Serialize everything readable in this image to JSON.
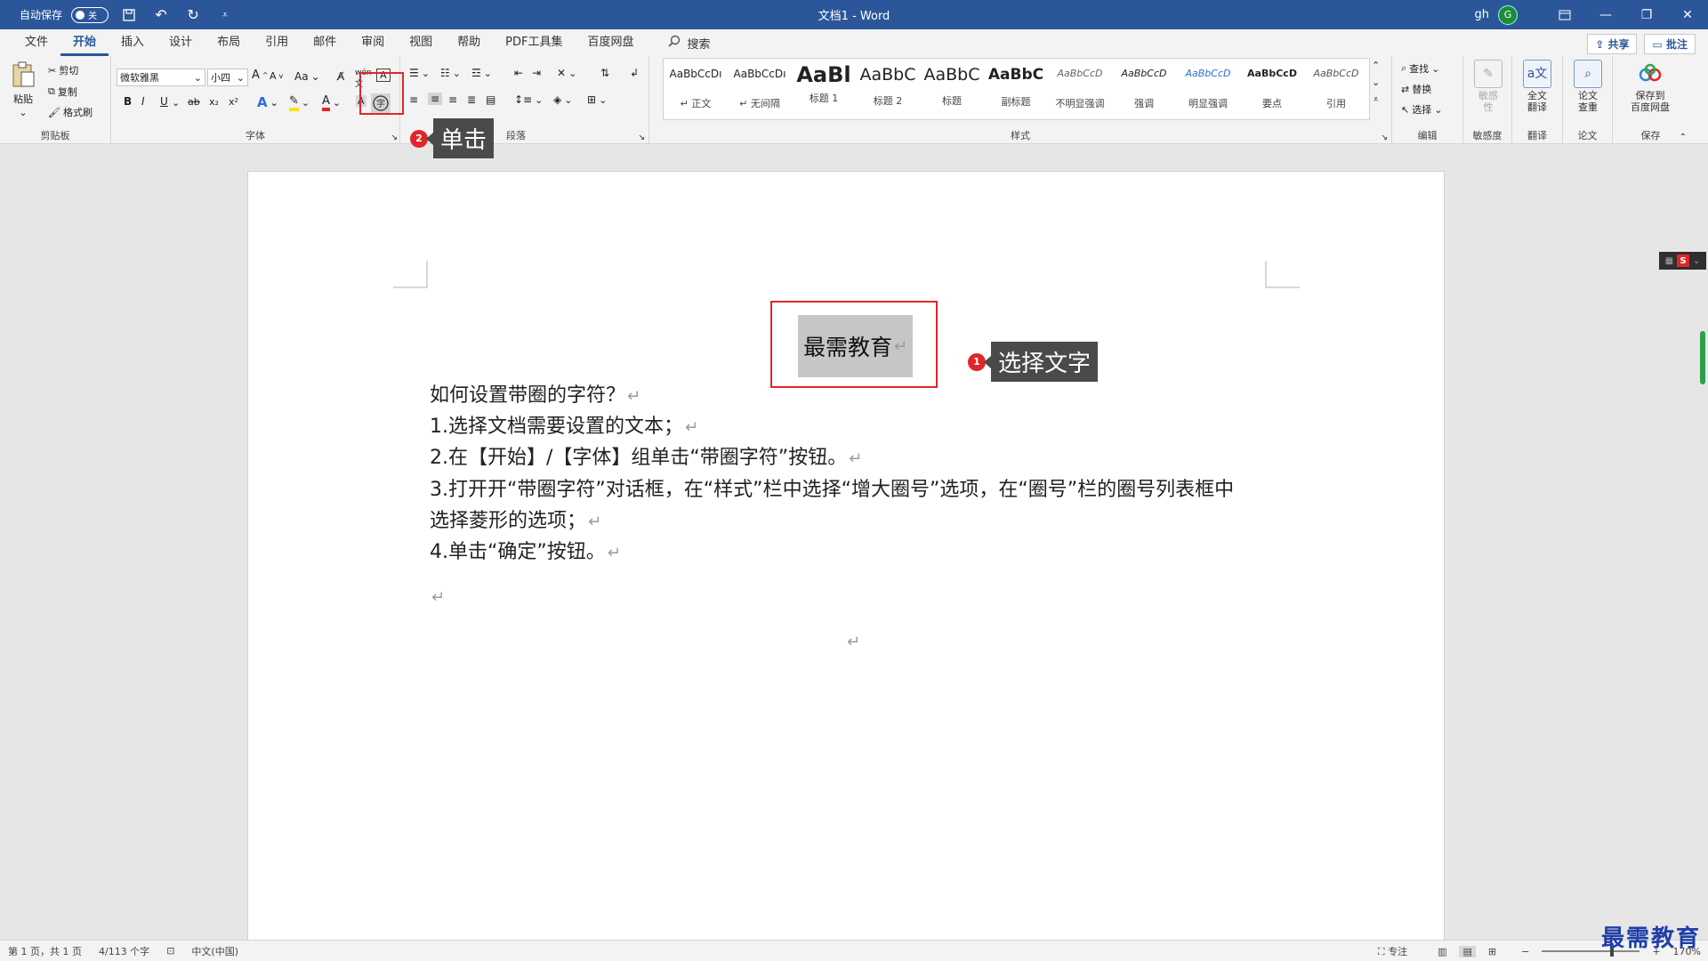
{
  "titlebar": {
    "autosave_label": "自动保存",
    "autosave_state": "关",
    "doc_title": "文档1 - Word",
    "user": "gh",
    "avatar_initial": "G",
    "quick_access": [
      "save-icon",
      "undo-icon",
      "redo-icon",
      "customize-icon"
    ],
    "window_buttons": [
      "ribbon-display-icon",
      "minimize-icon",
      "restore-icon",
      "close-icon"
    ]
  },
  "ribbon": {
    "tabs": [
      "文件",
      "开始",
      "插入",
      "设计",
      "布局",
      "引用",
      "邮件",
      "审阅",
      "视图",
      "帮助",
      "PDF工具集",
      "百度网盘"
    ],
    "active_tab": "开始",
    "search_label": "搜索",
    "share_label": "共享",
    "comments_label": "批注",
    "clipboard": {
      "paste": "粘贴",
      "cut": "剪切",
      "copy": "复制",
      "format_painter": "格式刷",
      "label": "剪贴板"
    },
    "font": {
      "font_name": "微软雅黑",
      "font_size": "小四",
      "label": "字体",
      "buttons": [
        "B",
        "I",
        "U",
        "ab",
        "x₂",
        "x²",
        "A",
        "Aa"
      ]
    },
    "paragraph": {
      "label": "段落"
    },
    "styles": {
      "label": "样式",
      "items": [
        {
          "preview": "AaBbCcDı",
          "name": "↵ 正文"
        },
        {
          "preview": "AaBbCcDı",
          "name": "↵ 无间隔"
        },
        {
          "preview": "AaBl",
          "name": "标题 1"
        },
        {
          "preview": "AaBbC",
          "name": "标题 2"
        },
        {
          "preview": "AaBbC",
          "name": "标题"
        },
        {
          "preview": "AaBbC",
          "name": "副标题"
        },
        {
          "preview": "AaBbCcD",
          "name": "不明显强调"
        },
        {
          "preview": "AaBbCcD",
          "name": "强调"
        },
        {
          "preview": "AaBbCcD",
          "name": "明显强调"
        },
        {
          "preview": "AaBbCcD",
          "name": "要点"
        },
        {
          "preview": "AaBbCcD",
          "name": "引用"
        }
      ]
    },
    "editing": {
      "find": "查找",
      "replace": "替换",
      "select": "选择",
      "label": "编辑"
    },
    "sensitivity": {
      "button": "敏感\n性",
      "label": "敏感度"
    },
    "translate": {
      "button": "全文\n翻译",
      "label": "翻译"
    },
    "paper": {
      "button": "论文\n查重",
      "label": "论文"
    },
    "save_cloud": {
      "button": "保存到\n百度网盘",
      "label": "保存"
    }
  },
  "document": {
    "title": "最需教育",
    "lines": [
      "如何设置带圈的字符？",
      "1.选择文档需要设置的文本；",
      "2.在【开始】/【字体】组单击“带圈字符”按钮。",
      "3.打开开“带圈字符”对话框，在“样式”栏中选择“增大圈号”选项，在“圈号”栏的圈号列表框中",
      "选择菱形的选项；",
      "4.单击“确定”按钮。"
    ],
    "paragraph_mark": "↵"
  },
  "annotations": [
    {
      "number": "1",
      "text": "选择文字"
    },
    {
      "number": "2",
      "text": "单击"
    }
  ],
  "statusbar": {
    "page": "第 1 页，共 1 页",
    "words": "4/113 个字",
    "language": "中文(中国)",
    "focus": "专注",
    "zoom": "170%"
  },
  "watermark": "最需教育",
  "colors": {
    "title_bar": "#2b579a",
    "highlight_box": "#e0262b",
    "callout_bg": "#4a4a4a",
    "selection": "#c6c6c6"
  }
}
